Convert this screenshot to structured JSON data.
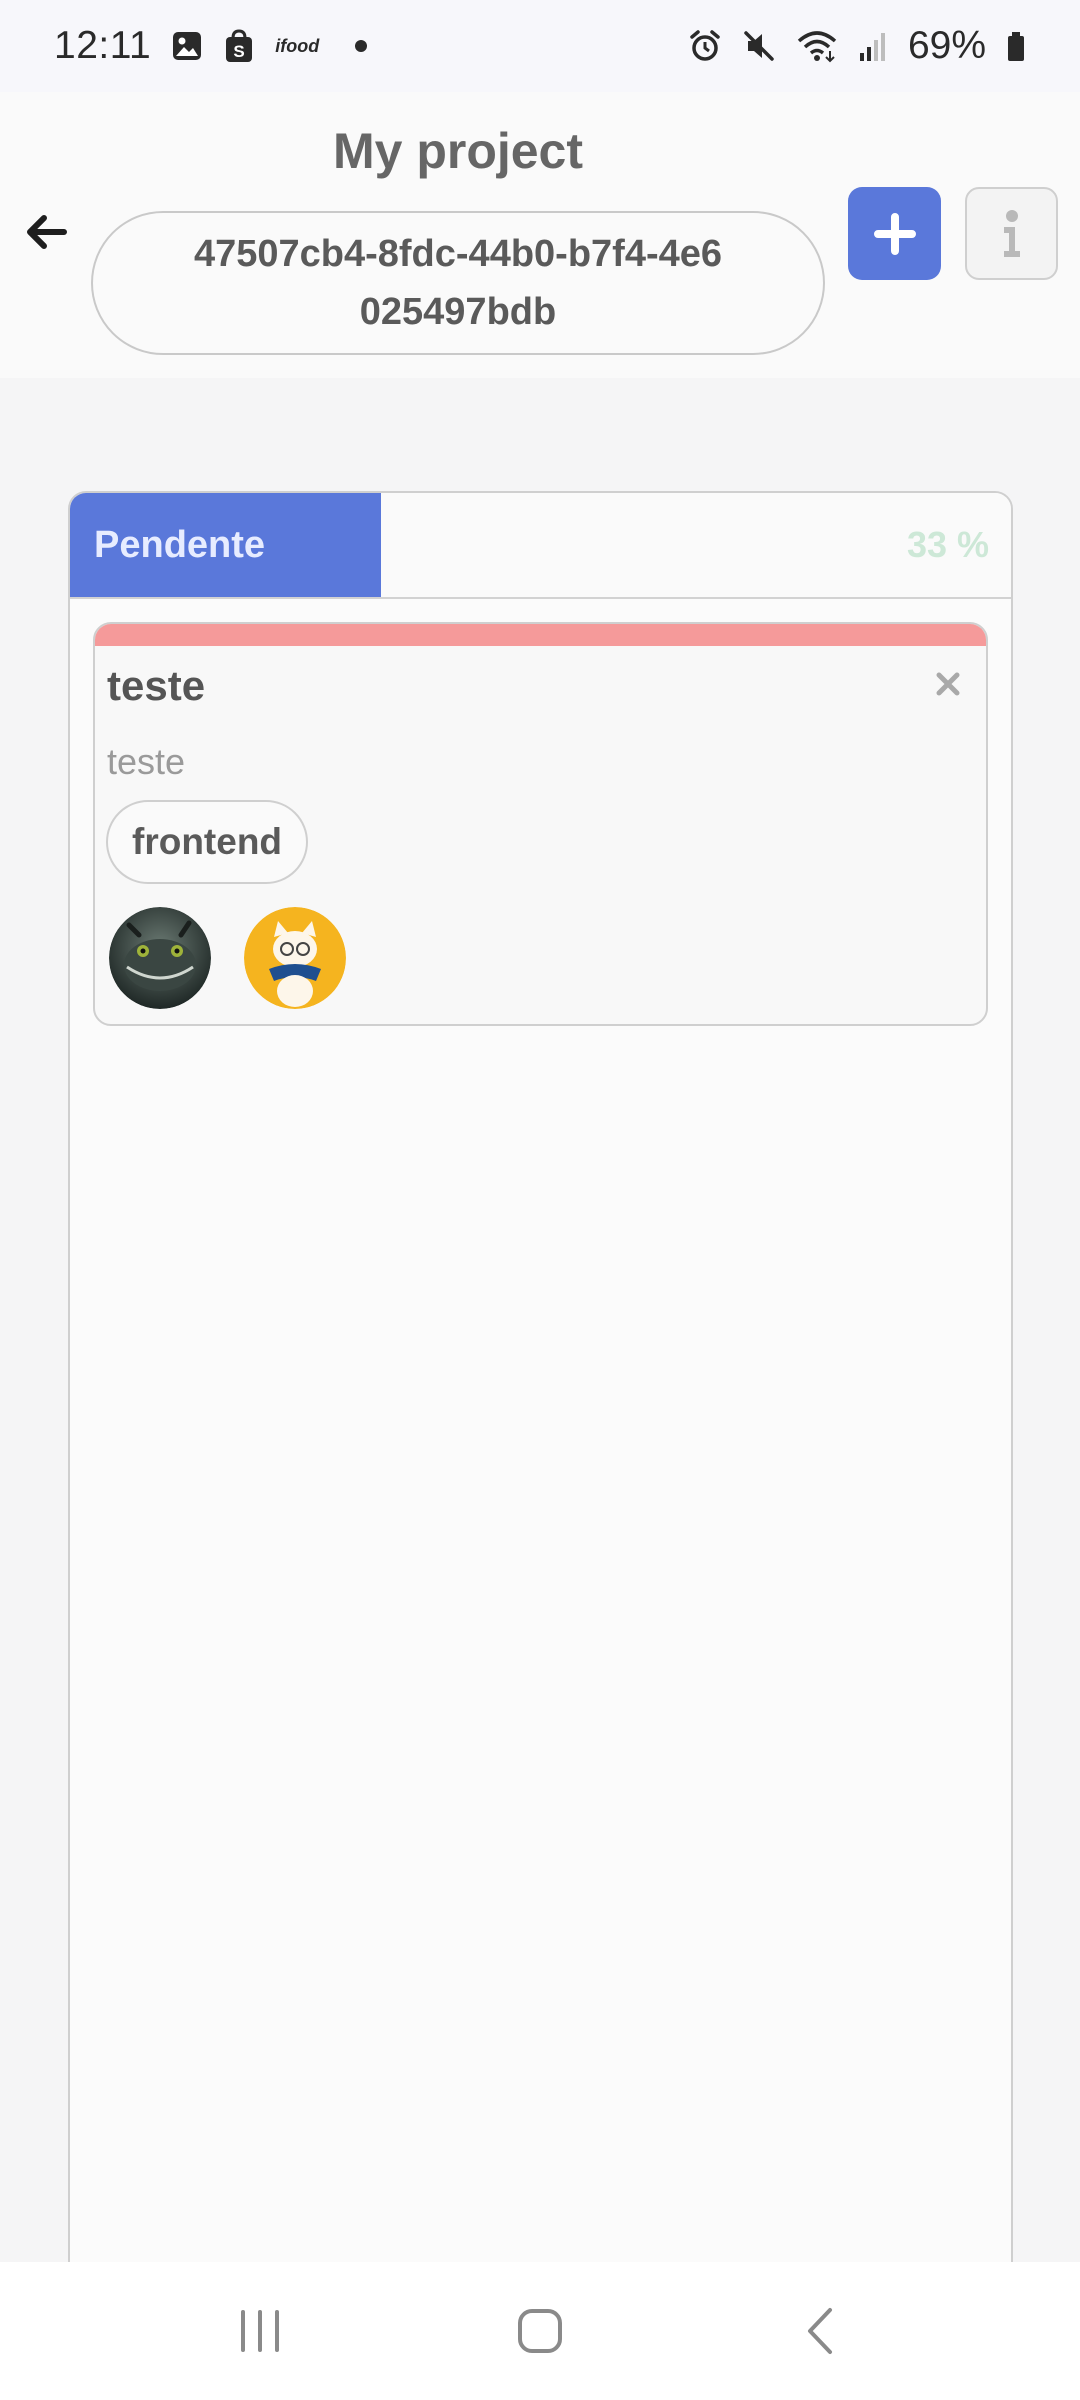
{
  "status_bar": {
    "time": "12:11",
    "notification_icons": [
      "gallery-icon",
      "shopping-bag-icon",
      "ifood-icon",
      "dot-icon"
    ],
    "ifood_label": "ifood",
    "system_icons": [
      "alarm-icon",
      "mute-icon",
      "wifi-icon",
      "signal-icon",
      "battery-icon"
    ],
    "battery": "69%"
  },
  "header": {
    "title": "My project",
    "project_id": "47507cb4-8fdc-44b0-b7f4-4e6025497bdb",
    "add_icon": "plus-icon",
    "info_icon": "info-icon",
    "back_icon": "arrow-left-icon"
  },
  "column": {
    "title": "Pendente",
    "percent_label": "33 %",
    "progress": 0.33,
    "accent_color": "#5a78da",
    "cards": [
      {
        "title": "teste",
        "description": "teste",
        "priority_color": "#f59a9a",
        "tags": [
          "frontend"
        ],
        "assignees": [
          "avatar-dragon",
          "avatar-cat"
        ]
      }
    ]
  },
  "nav_bar": {
    "items": [
      "recents-icon",
      "home-icon",
      "back-icon"
    ]
  }
}
